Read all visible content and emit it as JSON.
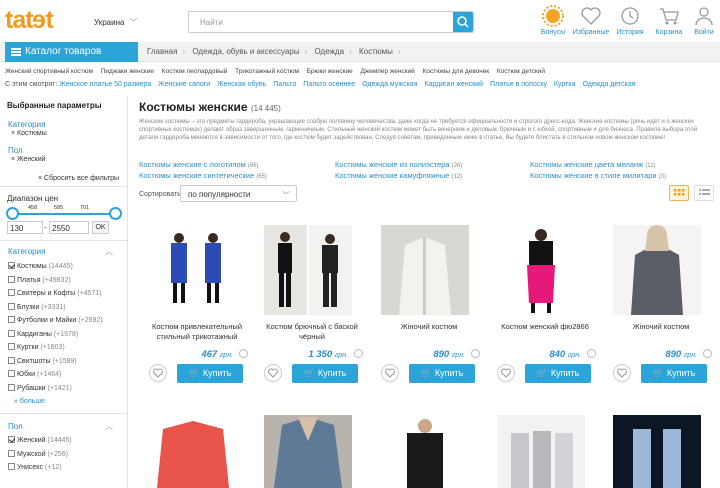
{
  "header": {
    "logo": "tatƏi",
    "region": "Украина",
    "search_placeholder": "Найти",
    "icons": [
      {
        "name": "bonus-icon",
        "label": "Бонусы"
      },
      {
        "name": "favorites-icon",
        "label": "Избранные"
      },
      {
        "name": "history-icon",
        "label": "История"
      },
      {
        "name": "cart-icon",
        "label": "Корзина"
      },
      {
        "name": "user-icon",
        "label": "Войти"
      }
    ]
  },
  "catalog_button": "Каталог товаров",
  "breadcrumbs": [
    "Главная",
    "Одежда, обувь и аксессуары",
    "Одежда",
    "Костюмы"
  ],
  "subtags": [
    "Женский спортивный костюм",
    "Пиджаки женские",
    "Костюм леопардовый",
    "Трикотажный костюм",
    "Брюки женские",
    "Джемпер женский",
    "Костюмы для девочек",
    "Костюм детский"
  ],
  "also_look": {
    "label": "С этим смотрят:",
    "links": [
      "Женское платье 50 размера",
      "Женские сапоги",
      "Женская обувь",
      "Пальто",
      "Пальто осеннее",
      "Одежда мужская",
      "Кардиган женский",
      "Платье в полоску",
      "Куртка",
      "Одежда детская"
    ]
  },
  "sidebar": {
    "selected_title": "Выбранные параметры",
    "cat_label": "Категория",
    "cat_value": "Костюмы",
    "gender_label": "Пол",
    "gender_value": "Женский",
    "reset": "Сбросить все фильтры",
    "price_title": "Диапазон цен",
    "ticks": [
      "458",
      "585",
      "701"
    ],
    "price_min": "130",
    "price_max": "2550",
    "ok": "OK",
    "category_title": "Категория",
    "categories": [
      {
        "label": "Костюмы",
        "count": "(14445)",
        "checked": true
      },
      {
        "label": "Платья",
        "count": "(+49832)",
        "checked": false
      },
      {
        "label": "Свитеры и Кофты",
        "count": "(+4571)",
        "checked": false
      },
      {
        "label": "Блузки",
        "count": "(+3331)",
        "checked": false
      },
      {
        "label": "Футболки и Майки",
        "count": "(+2692)",
        "checked": false
      },
      {
        "label": "Кардиганы",
        "count": "(+1978)",
        "checked": false
      },
      {
        "label": "Куртки",
        "count": "(+1603)",
        "checked": false
      },
      {
        "label": "Свитшоты",
        "count": "(+1589)",
        "checked": false
      },
      {
        "label": "Юбки",
        "count": "(+1464)",
        "checked": false
      },
      {
        "label": "Рубашки",
        "count": "(+1421)",
        "checked": false
      }
    ],
    "more": "больше",
    "gender_title": "Пол",
    "genders": [
      {
        "label": "Женский",
        "count": "(14445)",
        "checked": true
      },
      {
        "label": "Мужской",
        "count": "(+256)",
        "checked": false
      },
      {
        "label": "Унисекс",
        "count": "(+12)",
        "checked": false
      }
    ]
  },
  "main": {
    "title": "Костюмы женские",
    "count": "(14 445)",
    "description": "Женские костюмы – это предметы гардероба, украшающие слабую половину человечества, даже когда не требуется официальности и строгого дресс-кода. Женские костюмы (речь идет и о женских спортивных костюмах) делают образ завершенным, гармоничным. Стильный женский костюм может быть вечерним и деловым, брючным и с юбкой, спортивным и для бизнеса. Правила выбора этой детали гардероба меняются в зависимости от того, где костюм будет задействован. Следуя советам, приведенным ниже в статье, Вы будете блистать в стильном новом женском костюме!",
    "related": [
      {
        "label": "Костюмы женские с логотипом",
        "count": "(66)"
      },
      {
        "label": "Костюмы женские из полиэстера",
        "count": "(26)"
      },
      {
        "label": "Костюмы женские цвета меланж",
        "count": "(11)"
      },
      {
        "label": "Костюмы женские синтетические",
        "count": "(65)"
      },
      {
        "label": "Костюмы женские камуфляжные",
        "count": "(12)"
      },
      {
        "label": "Костюмы женские в стиле милитари",
        "count": "(3)"
      }
    ],
    "sort_label": "Сортировать",
    "sort_value": "по популярности",
    "currency": "грн.",
    "buy_label": "Купить",
    "products": [
      {
        "name": "Костюм привлекательный стильный трикотажный",
        "price": "467"
      },
      {
        "name": "Костюм брючный с баской чёрный",
        "price": "1 350"
      },
      {
        "name": "Жіночий костюм",
        "price": "890"
      },
      {
        "name": "Костюм женский фю2866",
        "price": "840"
      },
      {
        "name": "Жіночий костюм",
        "price": "890"
      }
    ]
  }
}
